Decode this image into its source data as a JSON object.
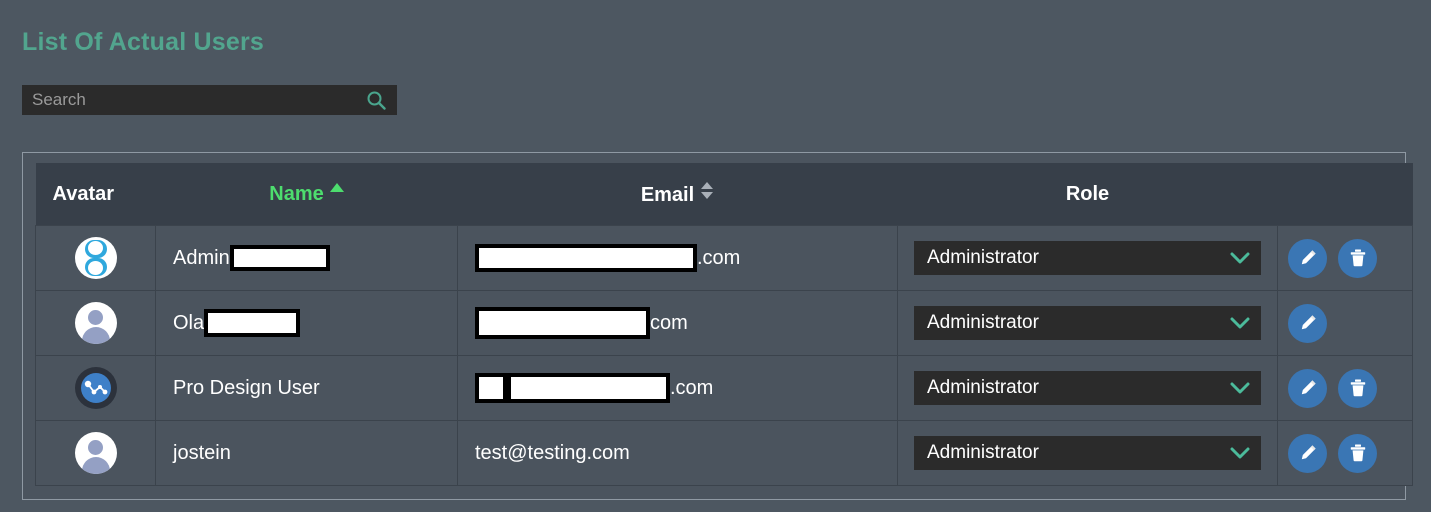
{
  "header": {
    "title": "List Of Actual Users"
  },
  "search": {
    "placeholder": "Search",
    "value": "",
    "icon": "search-icon"
  },
  "table": {
    "columns": [
      {
        "key": "avatar",
        "label": "Avatar",
        "sort": "none"
      },
      {
        "key": "name",
        "label": "Name",
        "sort": "asc"
      },
      {
        "key": "email",
        "label": "Email",
        "sort": "both"
      },
      {
        "key": "role",
        "label": "Role",
        "sort": "none"
      },
      {
        "key": "actions",
        "label": "",
        "sort": "none"
      }
    ],
    "rows": [
      {
        "avatar": "hourglass-logo-avatar",
        "name_visible": "Admin",
        "name_redacted": true,
        "email_visible": ".com",
        "email_redacted": true,
        "role": "Administrator",
        "has_edit": true,
        "has_delete": true
      },
      {
        "avatar": "default-person-avatar",
        "name_visible": "Ola",
        "name_redacted": true,
        "email_visible": "com",
        "email_redacted": true,
        "role": "Administrator",
        "has_edit": true,
        "has_delete": false
      },
      {
        "avatar": "chart-logo-avatar",
        "name_visible": "Pro Design User",
        "name_redacted": false,
        "email_visible": ".com",
        "email_redacted": true,
        "role": "Administrator",
        "has_edit": true,
        "has_delete": true
      },
      {
        "avatar": "default-person-avatar",
        "name_visible": "jostein",
        "name_redacted": false,
        "email_visible": "test@testing.com",
        "email_redacted": false,
        "role": "Administrator",
        "has_edit": true,
        "has_delete": true
      }
    ]
  },
  "colors": {
    "page_background": "#4d5761",
    "title": "#52a58e",
    "table_row": "#4b545e",
    "table_header": "#373f49",
    "sort_active": "#4ddd6e",
    "accent_teal": "#52a58e",
    "action_button": "#3a76b4",
    "input_background": "#2b2b2b"
  }
}
